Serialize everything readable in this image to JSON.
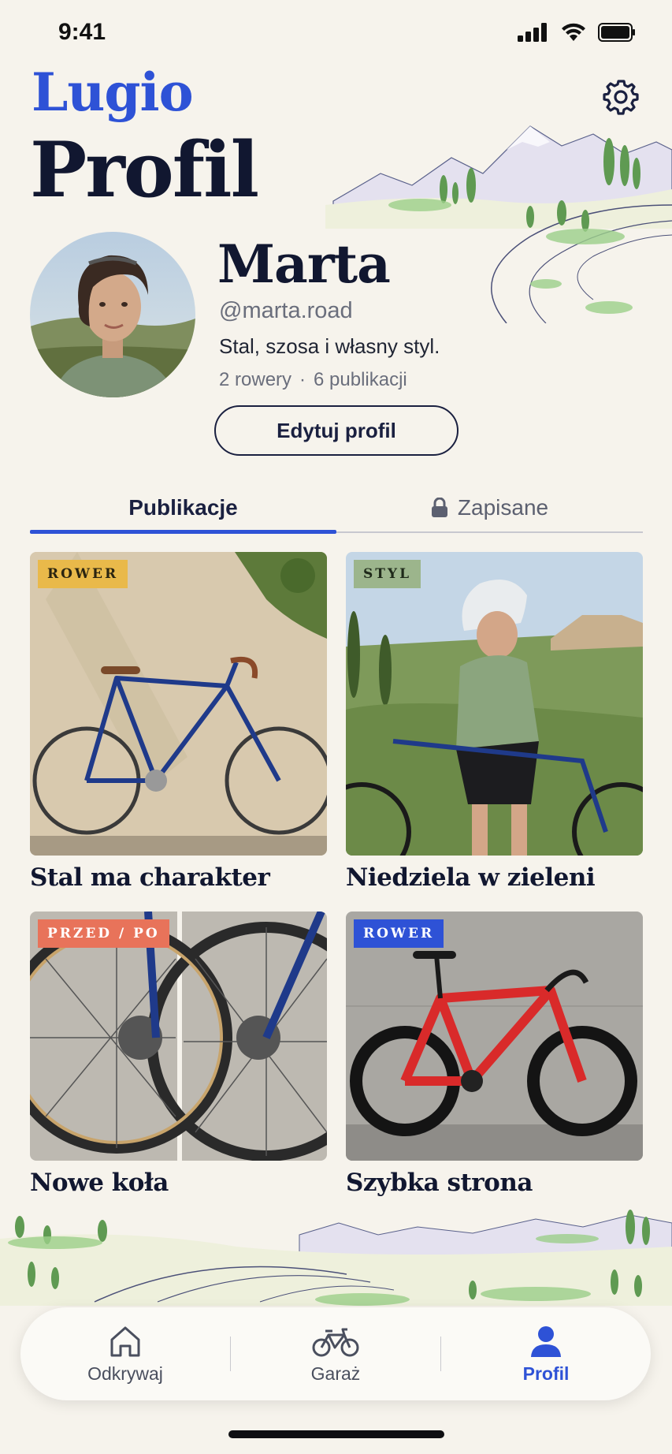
{
  "status_bar": {
    "time": "9:41"
  },
  "app": {
    "logo": "Lugio",
    "settings_icon": "gear-icon"
  },
  "page": {
    "title": "Profil"
  },
  "profile": {
    "name": "Marta",
    "handle": "@marta.road",
    "bio": "Stal, szosa i własny styl.",
    "bikes": "2 rowery",
    "separator": "·",
    "posts": "6 publikacji",
    "edit_label": "Edytuj profil"
  },
  "tabs": [
    {
      "label": "Publikacje",
      "active": true
    },
    {
      "label": "Zapisane",
      "icon": "lock-icon",
      "active": false
    }
  ],
  "posts": [
    {
      "badge": "ROWER",
      "badge_color": "#e9b94a",
      "badge_text_color": "#2a2410",
      "title": "Stal ma charakter"
    },
    {
      "badge": "STYL",
      "badge_color": "#9cb58c",
      "badge_text_color": "#1f2a1a",
      "title": "Niedziela w zieleni"
    },
    {
      "badge": "PRZED / PO",
      "badge_color": "#e8735a",
      "badge_text_color": "#ffffff",
      "title": "Nowe koła"
    },
    {
      "badge": "ROWER",
      "badge_color": "#2e52d6",
      "badge_text_color": "#ffffff",
      "title": "Szybka strona"
    }
  ],
  "nav": [
    {
      "label": "Odkrywaj",
      "icon": "home-icon",
      "active": false
    },
    {
      "label": "Garaż",
      "icon": "bicycle-icon",
      "active": false
    },
    {
      "label": "Profil",
      "icon": "person-icon",
      "active": true
    }
  ],
  "colors": {
    "accent": "#2e52d6",
    "background": "#f6f3ec",
    "ink": "#111730"
  }
}
